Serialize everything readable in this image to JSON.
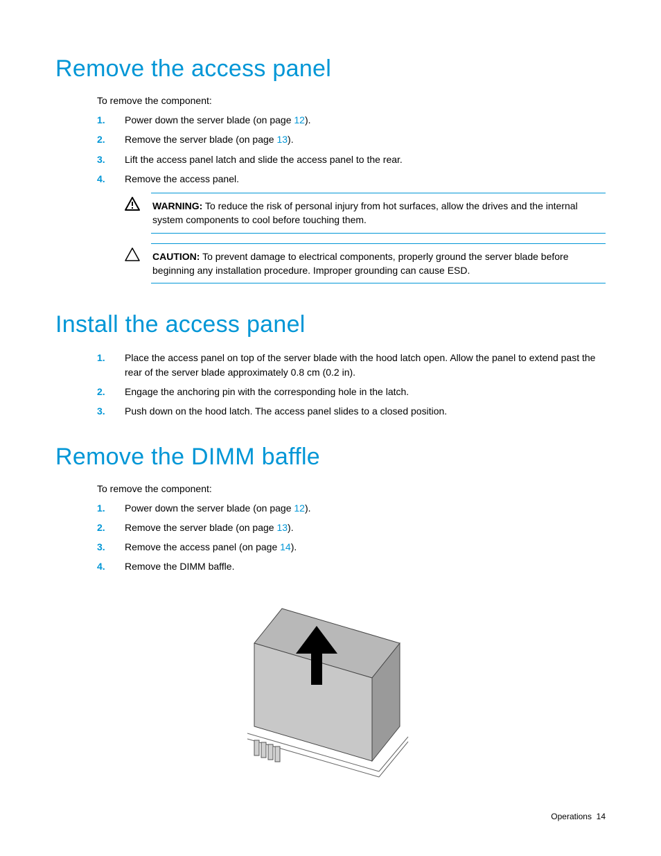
{
  "sections": {
    "remove_panel": {
      "title": "Remove the access panel",
      "intro": "To remove the component:",
      "steps": [
        {
          "pre": "Power down the server blade (on page ",
          "ref": "12",
          "post": ")."
        },
        {
          "pre": "Remove the server blade (on page ",
          "ref": "13",
          "post": ")."
        },
        {
          "text": "Lift the access panel latch and slide the access panel to the rear."
        },
        {
          "text": "Remove the access panel."
        }
      ],
      "warning": {
        "label": "WARNING:",
        "text": " To reduce the risk of personal injury from hot surfaces, allow the drives and the internal system components to cool before touching them."
      },
      "caution": {
        "label": "CAUTION:",
        "text": " To prevent damage to electrical components, properly ground the server blade before beginning any installation procedure. Improper grounding can cause ESD."
      }
    },
    "install_panel": {
      "title": "Install the access panel",
      "steps": [
        {
          "text": "Place the access panel on top of the server blade with the hood latch open. Allow the panel to extend past the rear of the server blade approximately 0.8 cm (0.2 in)."
        },
        {
          "text": "Engage the anchoring pin with the corresponding hole in the latch."
        },
        {
          "text": "Push down on the hood latch. The access panel slides to a closed position."
        }
      ]
    },
    "remove_dimm": {
      "title": "Remove the DIMM baffle",
      "intro": "To remove the component:",
      "steps": [
        {
          "pre": "Power down the server blade (on page ",
          "ref": "12",
          "post": ")."
        },
        {
          "pre": "Remove the server blade (on page ",
          "ref": "13",
          "post": ")."
        },
        {
          "pre": "Remove the access panel (on page ",
          "ref": "14",
          "post": ")."
        },
        {
          "text": "Remove the DIMM baffle."
        }
      ]
    }
  },
  "footer": {
    "section": "Operations",
    "page": "14"
  }
}
